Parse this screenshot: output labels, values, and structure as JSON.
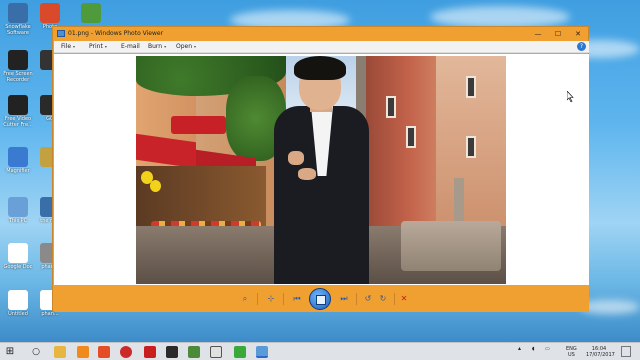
{
  "desktop": {
    "icons": [
      {
        "label": "Snowflake Software",
        "color": "#3a6ea8"
      },
      {
        "label": "Photo",
        "color": "#d84a2a"
      },
      {
        "label": "",
        "color": "#4f9a3a"
      },
      {
        "label": "Free Screen Recorder",
        "color": "#222222"
      },
      {
        "label": "",
        "color": "#333333"
      },
      {
        "label": "Free Video Cutter Fre...",
        "color": "#222222"
      },
      {
        "label": "GO",
        "color": "#2a2a2a"
      },
      {
        "label": "Magnifier",
        "color": "#3a7ad0"
      },
      {
        "label": "",
        "color": "#c3a040"
      },
      {
        "label": "This PC",
        "color": "#6aa0d8"
      },
      {
        "label": "the m...",
        "color": "#3a6ea8"
      },
      {
        "label": "Google Doc",
        "color": "#ffffff"
      },
      {
        "label": "phan...",
        "color": "#8a8a8a"
      },
      {
        "label": "Untitled",
        "color": "#ffffff"
      },
      {
        "label": "phan...",
        "color": "#ffffff"
      }
    ]
  },
  "window": {
    "title": "01.png - Windows Photo Viewer",
    "controls": {
      "minimize": "—",
      "maximize": "☐",
      "close": "✕"
    },
    "menu": [
      {
        "label": "File"
      },
      {
        "label": "Print"
      },
      {
        "label": "E-mail"
      },
      {
        "label": "Burn"
      },
      {
        "label": "Open"
      }
    ],
    "help_icon": "?",
    "toolbar": {
      "zoom": "⌕",
      "fit": "⊹",
      "previous": "⏮",
      "slideshow": "",
      "next": "⏭",
      "rotate_ccw": "↺",
      "rotate_cw": "↻",
      "delete": "✕"
    }
  },
  "taskbar": {
    "start_icon": "⊞",
    "search_icon": "○",
    "language": "ENG\nUS",
    "time": "16:04",
    "date": "17/07/2017"
  },
  "colors": {
    "window_frame": "#f0a030",
    "desktop_sky": "#5fb6ee",
    "taskbar": "#dfe3e8"
  }
}
